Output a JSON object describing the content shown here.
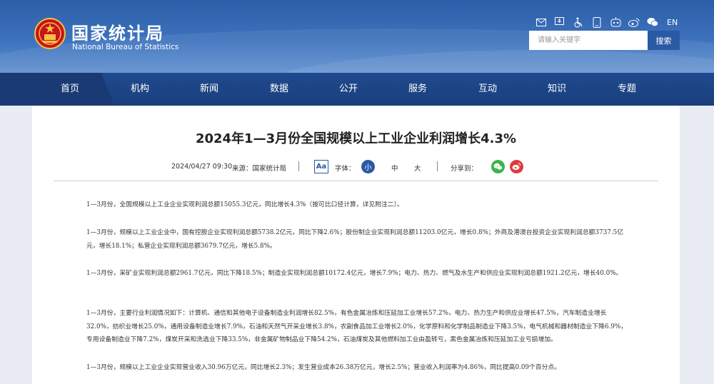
{
  "site": {
    "name_cn": "国家统计局",
    "name_en": "National Bureau of Statistics",
    "lang_link": "EN",
    "tool_icons": [
      "mail-icon",
      "accessibility-icon",
      "wheelchair-icon",
      "phone-icon",
      "robot-icon",
      "weibo-icon",
      "wechat-icon"
    ]
  },
  "search": {
    "placeholder": "请输入关键字",
    "button": "搜索"
  },
  "nav": {
    "items": [
      "首页",
      "机构",
      "新闻",
      "数据",
      "公开",
      "服务",
      "互动",
      "知识",
      "专题"
    ]
  },
  "article": {
    "title": "2024年1—3月份全国规模以上工业企业利润增长4.3%",
    "date": "2024/04/27 09:30",
    "source": "来源：国家统计局",
    "font_label": "字体：",
    "size_small": "小",
    "size_medium": "中",
    "size_large": "大",
    "share_label": "分享到：",
    "aa": "Aa",
    "paragraphs": [
      "1—3月份，全国规模以上工业企业实现利润总额15055.3亿元，同比增长4.3%（按可比口径计算，详见附注二）。",
      "1—3月份，规模以上工业企业中，国有控股企业实现利润总额5738.2亿元，同比下降2.6%；股份制企业实现利润总额11203.0亿元，增长0.8%；外商及港澳台投资企业实现利润总额3737.5亿元，增长18.1%；私营企业实现利润总额3679.7亿元，增长5.8%。",
      "1—3月份，采矿业实现利润总额2961.7亿元，同比下降18.5%；制造业实现利润总额10172.4亿元，增长7.9%；电力、热力、燃气及水生产和供应业实现利润总额1921.2亿元，增长40.0%。",
      "1—3月份，主要行业利润情况如下：计算机、通信和其他电子设备制造业利润增长82.5%，有色金属冶炼和压延加工业增长57.2%，电力、热力生产和供应业增长47.5%，汽车制造业增长32.0%，纺织业增长25.0%，通用设备制造业增长7.9%，石油和天然气开采业增长3.8%，农副食品加工业增长2.0%，化学原料和化学制品制造业下降3.5%，电气机械和器材制造业下降6.9%，专用设备制造业下降7.2%，煤炭开采和洗选业下降33.5%，非金属矿物制品业下降54.2%，石油煤炭及其他燃料加工业由盈转亏，黑色金属冶炼和压延加工业亏损增加。",
      "1—3月份，规模以上工业企业实现营业收入30.96万亿元，同比增长2.3%；发生营业成本26.38万亿元，增长2.5%；营业收入利润率为4.86%，同比提高0.09个百分点。"
    ]
  },
  "colors": {
    "header_blue": "#2c5ea8",
    "nav_blue": "#1f4a8f",
    "accent": "#2a5aa3",
    "wechat_green": "#3bb34a",
    "weibo_red": "#e0393e"
  }
}
